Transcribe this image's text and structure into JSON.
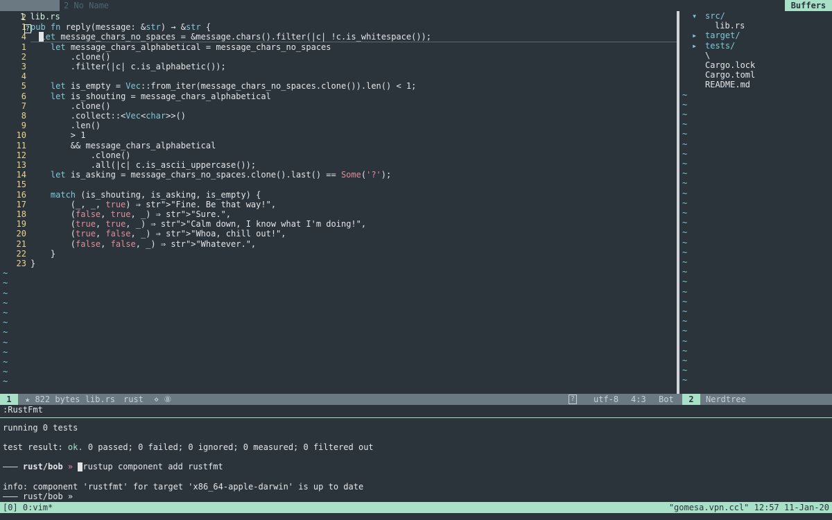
{
  "tabline": {
    "tab1": "1 lib.rs",
    "tab1_badge": "?",
    "tab2": "2 No Name",
    "buffers": "Buffers"
  },
  "editor": {
    "lines": [
      {
        "num": "2",
        "text": ""
      },
      {
        "num": "1",
        "text": "pub fn reply(message: &str) → &str {"
      },
      {
        "num": "4",
        "text": "  let message_chars_no_spaces = &message.chars().filter(|c| !c.is_whitespace());"
      },
      {
        "num": "1",
        "text": "    let message_chars_alphabetical = message_chars_no_spaces"
      },
      {
        "num": "2",
        "text": "        .clone()"
      },
      {
        "num": "3",
        "text": "        .filter(|c| c.is_alphabetic());"
      },
      {
        "num": "4",
        "text": ""
      },
      {
        "num": "5",
        "text": "    let is_empty = Vec::from_iter(message_chars_no_spaces.clone()).len() < 1;"
      },
      {
        "num": "6",
        "text": "    let is_shouting = message_chars_alphabetical"
      },
      {
        "num": "7",
        "text": "        .clone()"
      },
      {
        "num": "8",
        "text": "        .collect::<Vec<char>>()"
      },
      {
        "num": "9",
        "text": "        .len()"
      },
      {
        "num": "10",
        "text": "        > 1"
      },
      {
        "num": "11",
        "text": "        && message_chars_alphabetical"
      },
      {
        "num": "12",
        "text": "            .clone()"
      },
      {
        "num": "13",
        "text": "            .all(|c| c.is_ascii_uppercase());"
      },
      {
        "num": "14",
        "text": "    let is_asking = message_chars_no_spaces.clone().last() == Some('?');"
      },
      {
        "num": "15",
        "text": ""
      },
      {
        "num": "16",
        "text": "    match (is_shouting, is_asking, is_empty) {"
      },
      {
        "num": "17",
        "text": "        (_, _, true) ⇒ \"Fine. Be that way!\","
      },
      {
        "num": "18",
        "text": "        (false, true, _) ⇒ \"Sure.\","
      },
      {
        "num": "19",
        "text": "        (true, true, _) ⇒ \"Calm down, I know what I'm doing!\","
      },
      {
        "num": "20",
        "text": "        (true, false, _) ⇒ \"Whoa, chill out!\","
      },
      {
        "num": "21",
        "text": "        (false, false, _) ⇒ \"Whatever.\","
      },
      {
        "num": "22",
        "text": "    }"
      },
      {
        "num": "23",
        "text": "}"
      }
    ],
    "tilde": "~"
  },
  "tree": {
    "items": [
      {
        "arrow": "▾",
        "label": "src/",
        "kind": "dir",
        "indent": 0
      },
      {
        "arrow": "",
        "label": "lib.rs",
        "kind": "file",
        "indent": 1
      },
      {
        "arrow": "▸",
        "label": "target/",
        "kind": "dir",
        "indent": 0
      },
      {
        "arrow": "▸",
        "label": "tests/",
        "kind": "dir",
        "indent": 0
      },
      {
        "arrow": "",
        "label": "\\",
        "kind": "file",
        "indent": 0
      },
      {
        "arrow": "",
        "label": "Cargo.lock",
        "kind": "file",
        "indent": 0
      },
      {
        "arrow": "",
        "label": "Cargo.toml",
        "kind": "file",
        "indent": 0
      },
      {
        "arrow": "",
        "label": "README.md",
        "kind": "file",
        "indent": 0
      }
    ]
  },
  "status": {
    "num": "1",
    "file_info": "★ 822 bytes lib.rs",
    "filetype": "rust",
    "extra": "⋄ ⑧",
    "help": "?",
    "encoding": "utf-8",
    "position": "4:3",
    "scroll": "Bot",
    "right_num": "2",
    "right_label": "Nerdtree"
  },
  "cmdline": ":RustFmt",
  "terminal": {
    "running": "running 0 tests",
    "result_prefix": "test result: ",
    "result_ok": "ok.",
    "result_rest": " 0 passed; 0 failed; 0 ignored; 0 measured; 0 filtered out",
    "prompt1_dash": "––– ",
    "prompt1_path": "rust/bob",
    "prompt1_arrow": " » ",
    "command": "rustup component add rustfmt",
    "info": "info: component 'rustfmt' for target 'x86_64-apple-darwin' is up to date",
    "prompt2": "––– rust/bob »"
  },
  "tmux": {
    "left": "[0] 0:vim*",
    "right": "\"gomesa.vpn.ccl\" 12:57 11-Jan-20"
  },
  "colors": {
    "background": "#2b343b",
    "accent": "#a8e0c8",
    "line_number": "#e8d58a",
    "keyword": "#7ec8d8",
    "literal": "#e08c9a"
  }
}
